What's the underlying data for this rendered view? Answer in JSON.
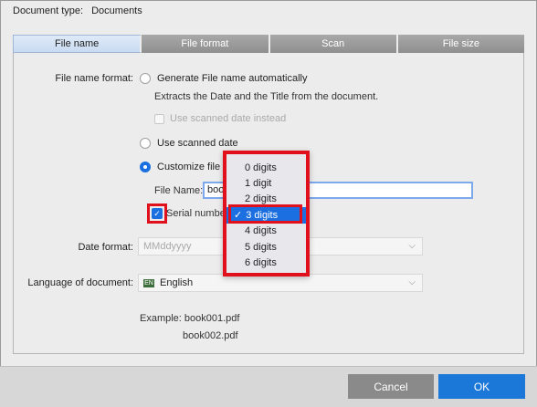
{
  "doc_type": {
    "label": "Document type:",
    "value": "Documents"
  },
  "tabs": [
    {
      "label": "File name",
      "active": true
    },
    {
      "label": "File format",
      "active": false
    },
    {
      "label": "Scan",
      "active": false
    },
    {
      "label": "File size",
      "active": false
    }
  ],
  "file_name_format": {
    "label": "File name format:",
    "auto": {
      "label": "Generate File name automatically",
      "note": "Extracts the Date and the Title from the document.",
      "sub_option": "Use scanned date instead"
    },
    "scanned_date": {
      "label": "Use scanned date"
    },
    "customize": {
      "label": "Customize file n",
      "selected": true
    },
    "file_name": {
      "label": "File Name:",
      "value": "book"
    },
    "serial": {
      "label": "Serial number",
      "checked": true
    }
  },
  "digits_menu": {
    "items": [
      "0 digits",
      "1 digit",
      "2 digits",
      "3 digits",
      "4 digits",
      "5 digits",
      "6 digits"
    ],
    "selected": "3 digits",
    "check_glyph": "✓"
  },
  "date_format": {
    "label": "Date format:",
    "value": "MMddyyyy"
  },
  "language": {
    "label": "Language of document:",
    "value": "English",
    "flag_icon": "EN"
  },
  "example": {
    "label": "Example:",
    "line1": "book001.pdf",
    "line2": "book002.pdf"
  },
  "buttons": {
    "cancel": "Cancel",
    "ok": "OK"
  },
  "colors": {
    "accent": "#1b6fe0",
    "highlight_box": "#e0101c"
  }
}
